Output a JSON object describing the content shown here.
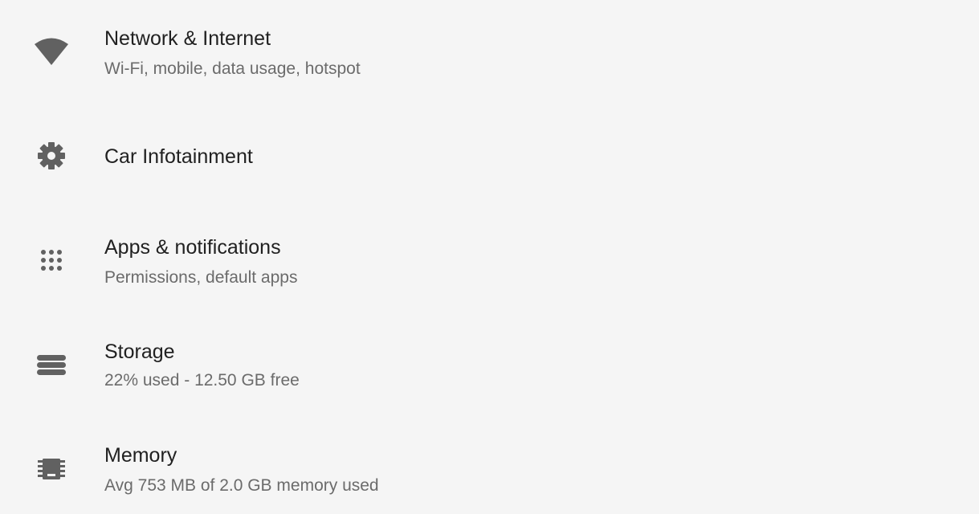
{
  "settings": {
    "items": [
      {
        "id": "network",
        "icon": "wifi-icon",
        "title": "Network & Internet",
        "summary": "Wi-Fi, mobile, data usage, hotspot"
      },
      {
        "id": "car-infotainment",
        "icon": "gear-icon",
        "title": "Car Infotainment",
        "summary": ""
      },
      {
        "id": "apps",
        "icon": "apps-grid-icon",
        "title": "Apps & notifications",
        "summary": "Permissions, default apps"
      },
      {
        "id": "storage",
        "icon": "storage-icon",
        "title": "Storage",
        "summary": "22% used - 12.50 GB free"
      },
      {
        "id": "memory",
        "icon": "memory-chip-icon",
        "title": "Memory",
        "summary": "Avg 753 MB of 2.0 GB memory used"
      }
    ]
  },
  "colors": {
    "background": "#f5f5f5",
    "title": "#212121",
    "summary": "#6b6b6b",
    "icon": "#616161"
  }
}
